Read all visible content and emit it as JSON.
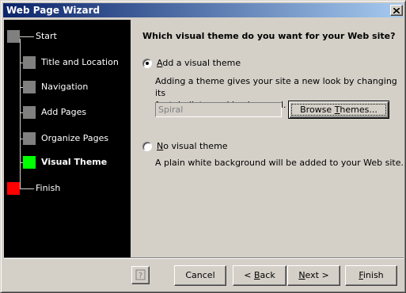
{
  "window": {
    "title": "Web Page Wizard"
  },
  "steps": [
    {
      "label": "Start",
      "state": "done",
      "color": "#808080"
    },
    {
      "label": "Title and Location",
      "state": "done",
      "color": "#808080"
    },
    {
      "label": "Navigation",
      "state": "done",
      "color": "#808080"
    },
    {
      "label": "Add Pages",
      "state": "done",
      "color": "#808080"
    },
    {
      "label": "Organize Pages",
      "state": "done",
      "color": "#808080"
    },
    {
      "label": "Visual Theme",
      "state": "current",
      "color": "#00ff00"
    },
    {
      "label": "Finish",
      "state": "pending",
      "color": "#ff0000"
    }
  ],
  "content": {
    "question": "Which visual theme do you want for your Web site?",
    "option_theme": {
      "label_pre": "",
      "label_key": "A",
      "label_post": "dd a visual theme",
      "selected": true,
      "description_line1": "Adding a theme gives your site a new look by changing its",
      "description_line2": "font, bullets, and background."
    },
    "theme_field": {
      "value": "Spiral",
      "enabled": false
    },
    "browse_button": {
      "label_pre": "Browse ",
      "label_key": "T",
      "label_post": "hemes..."
    },
    "option_none": {
      "label_pre": "",
      "label_key": "N",
      "label_post": "o visual theme",
      "selected": false,
      "description": "A plain white background will be added to your Web site."
    }
  },
  "footer": {
    "help_icon": "help-icon",
    "cancel": "Cancel",
    "back": {
      "label_pre": "< ",
      "label_key": "B",
      "label_post": "ack"
    },
    "next": {
      "label_pre": "",
      "label_key": "N",
      "label_post": "ext >"
    },
    "finish": {
      "label_pre": "",
      "label_key": "F",
      "label_post": "inish"
    }
  }
}
